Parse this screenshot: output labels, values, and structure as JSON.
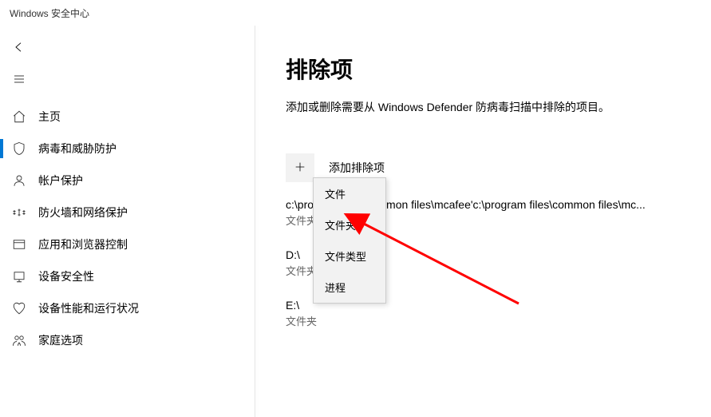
{
  "window": {
    "title": "Windows 安全中心"
  },
  "sidebar": {
    "items": [
      {
        "label": "主页"
      },
      {
        "label": "病毒和威胁防护"
      },
      {
        "label": "帐户保护"
      },
      {
        "label": "防火墙和网络保护"
      },
      {
        "label": "应用和浏览器控制"
      },
      {
        "label": "设备安全性"
      },
      {
        "label": "设备性能和运行状况"
      },
      {
        "label": "家庭选项"
      }
    ]
  },
  "main": {
    "title": "排除项",
    "description": "添加或删除需要从 Windows Defender 防病毒扫描中排除的项目。",
    "add_label": "添加排除项",
    "entries": [
      {
        "path": "c:\\program files\\common files\\mcafee'c:\\program files\\common files\\mc...",
        "type": "文件夹"
      },
      {
        "path": "D:\\",
        "type": "文件夹"
      },
      {
        "path": "E:\\",
        "type": "文件夹"
      }
    ]
  },
  "popup": {
    "items": [
      {
        "label": "文件"
      },
      {
        "label": "文件夹"
      },
      {
        "label": "文件类型"
      },
      {
        "label": "进程"
      }
    ]
  }
}
